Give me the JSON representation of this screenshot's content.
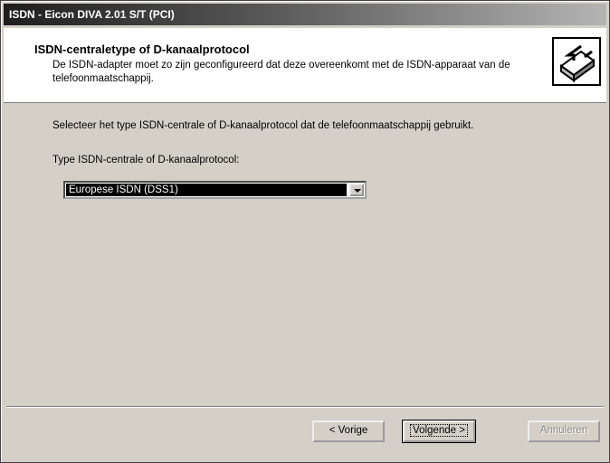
{
  "window": {
    "title": "ISDN - Eicon DIVA 2.01 S/T (PCI)"
  },
  "header": {
    "title": "ISDN-centraletype of D-kanaalprotocol",
    "subtitle": "De ISDN-adapter moet zo zijn geconfigureerd dat deze overeenkomt met de ISDN-apparaat van de telefoonmaatschappij."
  },
  "content": {
    "instruction": "Selecteer het type ISDN-centrale of D-kanaalprotocol dat de telefoonmaatschappij gebruikt.",
    "combo_label": "Type ISDN-centrale of D-kanaalprotocol:",
    "combo_value": "Europese ISDN (DSS1)"
  },
  "buttons": {
    "back": "< Vorige",
    "next": "Volgende >",
    "cancel": "Annuleren"
  },
  "icons": {
    "wizard": "network-adapter-icon"
  }
}
